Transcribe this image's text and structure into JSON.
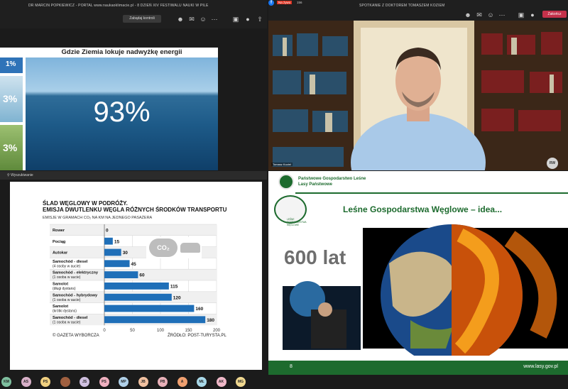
{
  "left_header": {
    "title": "DR MARCIN POPKIEWICZ - PORTAL www.naukaoklimacie.pl - 8 DZIEŃ XIV FESTIWALU NAUKI W PILE",
    "control_button": "Zabądaj kontroli"
  },
  "right_header": {
    "title": "SPOTKANIE Z DOKTOREM TOMASZEM KOZIEM",
    "leave_button": "Zakończ",
    "live_label": "Na żywo",
    "viewers": "156"
  },
  "slide_top": {
    "title": "Gdzie Ziemia lokuje nadwyżkę energii",
    "big_percent": "93%",
    "side_values": [
      "1%",
      "3%",
      "3%"
    ]
  },
  "share_bar": {
    "label": "Wyszukiwanie"
  },
  "chart": {
    "title_line1": "ŚLAD WĘGLOWY W PODRÓŻY.",
    "title_line2": "EMISJA DWUTLENKU WĘGLA RÓŻNYCH ŚRODKÓW TRANSPORTU",
    "subtitle": "EMISJE W GRAMACH CO₂ NA KM NA JEDNEGO PASAŻERA",
    "co2_label": "CO₂",
    "footer_left": "© GAZETA WYBORCZA",
    "footer_right": "ŹRÓDŁO: POST-TURYSTA.PL"
  },
  "chart_data": {
    "type": "bar",
    "orientation": "horizontal",
    "title": "ŚLAD WĘGLOWY W PODRÓŻY. EMISJA DWUTLENKU WĘGLA RÓŻNYCH ŚRODKÓW TRANSPORTU",
    "xlabel": "",
    "ylabel": "",
    "xlim": [
      0,
      200
    ],
    "xticks": [
      0,
      50,
      100,
      150,
      200
    ],
    "color": "#1f6fb8",
    "categories": [
      {
        "label": "Rower",
        "sub": "",
        "value": 0
      },
      {
        "label": "Pociąg",
        "sub": "",
        "value": 15
      },
      {
        "label": "Autokar",
        "sub": "",
        "value": 30
      },
      {
        "label": "Samochód - diesel",
        "sub": "(4 osoby w aucie)",
        "value": 45
      },
      {
        "label": "Samochód - elektryczny",
        "sub": "(1 osoba w aucie)",
        "value": 60
      },
      {
        "label": "Samolot",
        "sub": "(długi dystans)",
        "value": 115
      },
      {
        "label": "Samochód - hybrydowy",
        "sub": "(1 osoba w aucie)",
        "value": 120
      },
      {
        "label": "Samolot",
        "sub": "(krótki dystans)",
        "value": 160
      },
      {
        "label": "Samochód - diesel",
        "sub": "(1 osoba w aucie)",
        "value": 180
      }
    ]
  },
  "video": {
    "name_tag": "Tomasz Kozieł",
    "initials": "RW"
  },
  "slide_bottom": {
    "org_line1": "Państwowe Gospodarstwo Leśne",
    "org_line2": "Lasy Państwowe",
    "badge_text": "LEŚNE GOSPODARSTWA WĘGLOWE",
    "title": "Leśne Gospodarstwa Węglowe – idea...",
    "years": "600 lat",
    "page_number": "8",
    "website": "www.lasy.gov.pl"
  },
  "participants": [
    {
      "initials": "KM",
      "color": "#7fbf9f"
    },
    {
      "initials": "AS",
      "color": "#d8b0c8"
    },
    {
      "initials": "PS",
      "color": "#f0d080"
    },
    {
      "initials": "",
      "color": "#a06040"
    },
    {
      "initials": "JS",
      "color": "#d0c0e0"
    },
    {
      "initials": "PS",
      "color": "#f0b0c0"
    },
    {
      "initials": "MP",
      "color": "#b0d0e8"
    },
    {
      "initials": "JB",
      "color": "#f0c0a0"
    },
    {
      "initials": "PB",
      "color": "#e8b0b8"
    },
    {
      "initials": "A",
      "color": "#f0a070"
    },
    {
      "initials": "MŁ",
      "color": "#a8d8e8"
    },
    {
      "initials": "AK",
      "color": "#f0b8c8"
    },
    {
      "initials": "MG",
      "color": "#f0d890"
    }
  ]
}
